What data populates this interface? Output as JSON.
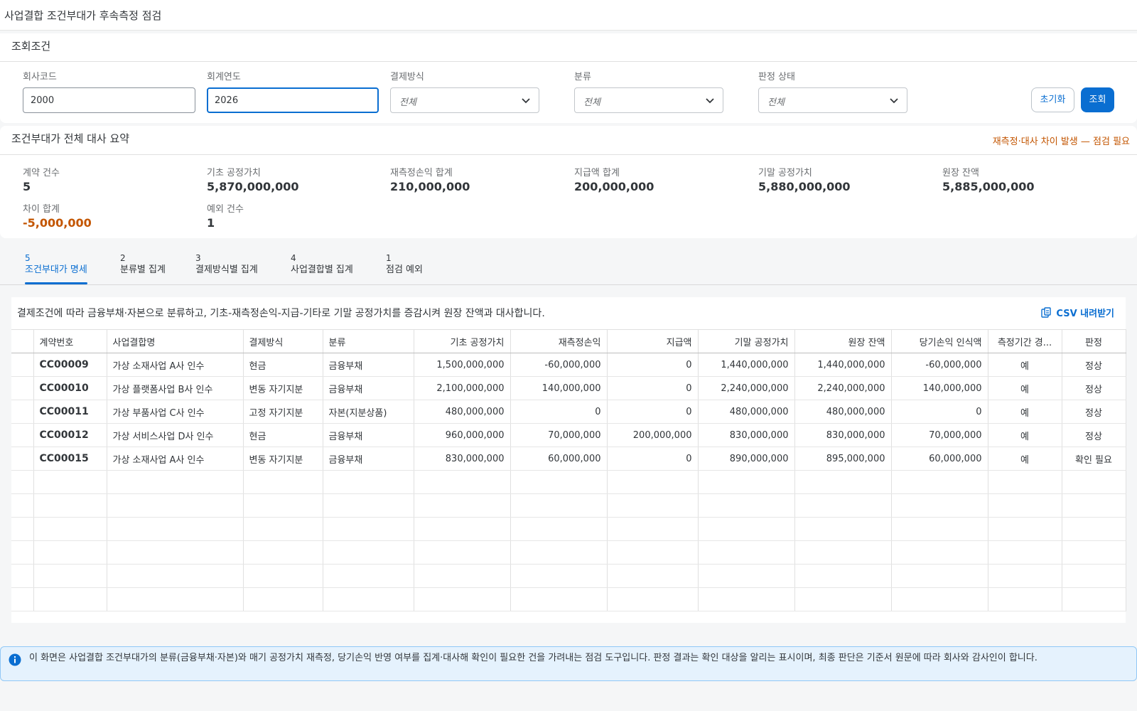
{
  "page": {
    "title": "사업결합 조건부대가 후속측정 점검"
  },
  "filters": {
    "header": "조회조건",
    "company_code": {
      "label": "회사코드",
      "value": "2000"
    },
    "fiscal_year": {
      "label": "회계연도",
      "value": "2026"
    },
    "settlement": {
      "label": "결제방식",
      "value": "전체"
    },
    "classification": {
      "label": "분류",
      "value": "전체"
    },
    "judgment_status": {
      "label": "판정 상태",
      "value": "전체"
    },
    "reset_label": "초기화",
    "search_label": "조회"
  },
  "summary": {
    "header": "조건부대가 전체 대사 요약",
    "warning": "재측정·대사 차이 발생 — 점검 필요",
    "kpis": [
      {
        "label": "계약 건수",
        "value": "5"
      },
      {
        "label": "기초 공정가치",
        "value": "5,870,000,000"
      },
      {
        "label": "재측정손익 합계",
        "value": "210,000,000"
      },
      {
        "label": "지급액 합계",
        "value": "200,000,000"
      },
      {
        "label": "기말 공정가치",
        "value": "5,880,000,000"
      },
      {
        "label": "원장 잔액",
        "value": "5,885,000,000"
      },
      {
        "label": "차이 합계",
        "value": "-5,000,000"
      },
      {
        "label": "예외 건수",
        "value": "1"
      }
    ]
  },
  "tabs": [
    {
      "count": "5",
      "label": "조건부대가 명세"
    },
    {
      "count": "2",
      "label": "분류별 집계"
    },
    {
      "count": "3",
      "label": "결제방식별 집계"
    },
    {
      "count": "4",
      "label": "사업결합별 집계"
    },
    {
      "count": "1",
      "label": "점검 예외"
    }
  ],
  "table": {
    "description": "결제조건에 따라 금융부채·자본으로 분류하고, 기초-재측정손익-지급-기타로 기말 공정가치를 증감시켜 원장 잔액과 대사합니다.",
    "csv_label": "CSV 내려받기",
    "columns": [
      "계약번호",
      "사업결합명",
      "결제방식",
      "분류",
      "기초 공정가치",
      "재측정손익",
      "지급액",
      "기말 공정가치",
      "원장 잔액",
      "당기손익 인식액",
      "측정기간 경...",
      "판정"
    ],
    "rows": [
      {
        "id": "CC00009",
        "name": "가상 소재사업 A사 인수",
        "settle": "현금",
        "cls": "금융부채",
        "open": "1,500,000,000",
        "remeas": "-60,000,000",
        "paid": "0",
        "close": "1,440,000,000",
        "ledger": "1,440,000,000",
        "pl": "-60,000,000",
        "period": "예",
        "judge": "정상"
      },
      {
        "id": "CC00010",
        "name": "가상 플랫폼사업 B사 인수",
        "settle": "변동 자기지분",
        "cls": "금융부채",
        "open": "2,100,000,000",
        "remeas": "140,000,000",
        "paid": "0",
        "close": "2,240,000,000",
        "ledger": "2,240,000,000",
        "pl": "140,000,000",
        "period": "예",
        "judge": "정상"
      },
      {
        "id": "CC00011",
        "name": "가상 부품사업 C사 인수",
        "settle": "고정 자기지분",
        "cls": "자본(지분상품)",
        "open": "480,000,000",
        "remeas": "0",
        "paid": "0",
        "close": "480,000,000",
        "ledger": "480,000,000",
        "pl": "0",
        "period": "예",
        "judge": "정상"
      },
      {
        "id": "CC00012",
        "name": "가상 서비스사업 D사 인수",
        "settle": "현금",
        "cls": "금융부채",
        "open": "960,000,000",
        "remeas": "70,000,000",
        "paid": "200,000,000",
        "close": "830,000,000",
        "ledger": "830,000,000",
        "pl": "70,000,000",
        "period": "예",
        "judge": "정상"
      },
      {
        "id": "CC00015",
        "name": "가상 소재사업 A사 인수",
        "settle": "변동 자기지분",
        "cls": "금융부채",
        "open": "830,000,000",
        "remeas": "60,000,000",
        "paid": "0",
        "close": "890,000,000",
        "ledger": "895,000,000",
        "pl": "60,000,000",
        "period": "예",
        "judge": "확인 필요"
      }
    ]
  },
  "info": {
    "text": "이 화면은 사업결합 조건부대가의 분류(금융부채·자본)와 매기 공정가치 재측정, 당기손익 반영 여부를 집계·대사해 확인이 필요한 건을 가려내는 점검 도구입니다. 판정 결과는 확인 대상을 알리는 표시이며, 최종 판단은 기준서 원문에 따라 회사와 감사인이 합니다."
  },
  "colors": {
    "accent": "#0a6ed1",
    "warning": "#c35500",
    "ok": "#107e3e"
  }
}
